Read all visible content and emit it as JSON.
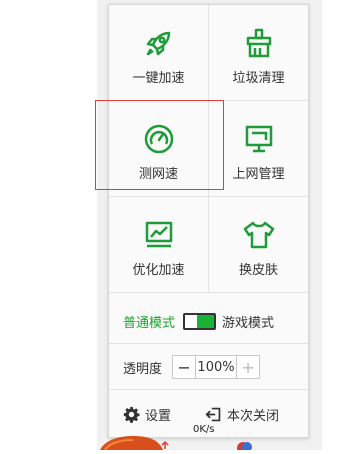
{
  "menu": {
    "tiles": [
      {
        "label": "一键加速",
        "icon": "rocket-icon"
      },
      {
        "label": "垃圾清理",
        "icon": "broom-icon"
      },
      {
        "label": "测网速",
        "icon": "speedometer-icon"
      },
      {
        "label": "上网管理",
        "icon": "monitor-icon"
      },
      {
        "label": "优化加速",
        "icon": "chart-monitor-icon"
      },
      {
        "label": "换皮肤",
        "icon": "tshirt-icon"
      }
    ],
    "mode": {
      "normal": "普通模式",
      "game": "游戏模式",
      "state": "normal"
    },
    "opacity": {
      "label": "透明度",
      "value": "100%",
      "minus": "−",
      "plus": "+"
    },
    "settings": {
      "label": "设置",
      "icon": "gear-icon"
    },
    "close_this_time": {
      "label": "本次关闭",
      "icon": "exit-icon"
    }
  },
  "footer": {
    "speed": "0K/s"
  },
  "colors": {
    "accent": "#19b437",
    "icon_green": "#1f9c3a",
    "selection": "#e33b3b"
  }
}
